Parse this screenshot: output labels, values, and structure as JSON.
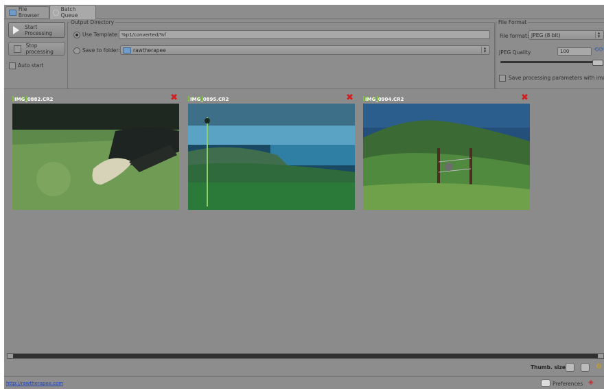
{
  "tabs": [
    {
      "label": "File Browser",
      "icon": "folder-icon"
    },
    {
      "label": "Batch Queue",
      "icon": "gear-icon"
    }
  ],
  "controls": {
    "start_label": "Start Processing",
    "stop_label": "Stop processing",
    "autostart_label": "Auto start"
  },
  "output": {
    "title": "Output Directory",
    "use_template_label": "Use Template:",
    "template_value": "%p1/converted/%f",
    "save_to_folder_label": "Save to folder:",
    "folder_value": "rawtherapee"
  },
  "format": {
    "title": "File Format",
    "file_format_label": "File format:",
    "file_format_value": "JPEG (8 bit)",
    "quality_label": "JPEG Quality",
    "quality_value": "100",
    "save_params_label": "Save processing parameters with image"
  },
  "thumbnails": [
    {
      "filename": "IMG_0882.CR2"
    },
    {
      "filename": "IMG_0895.CR2"
    },
    {
      "filename": "IMG_0904.CR2"
    }
  ],
  "bottom": {
    "thumb_size_label": "Thumb. size:"
  },
  "status": {
    "link": "http://rawtherapee.com",
    "preferences_label": "Preferences"
  },
  "colors": {
    "panel": "#8d8d8d",
    "delete": "#d21e1e",
    "link": "#1d3fc0"
  }
}
